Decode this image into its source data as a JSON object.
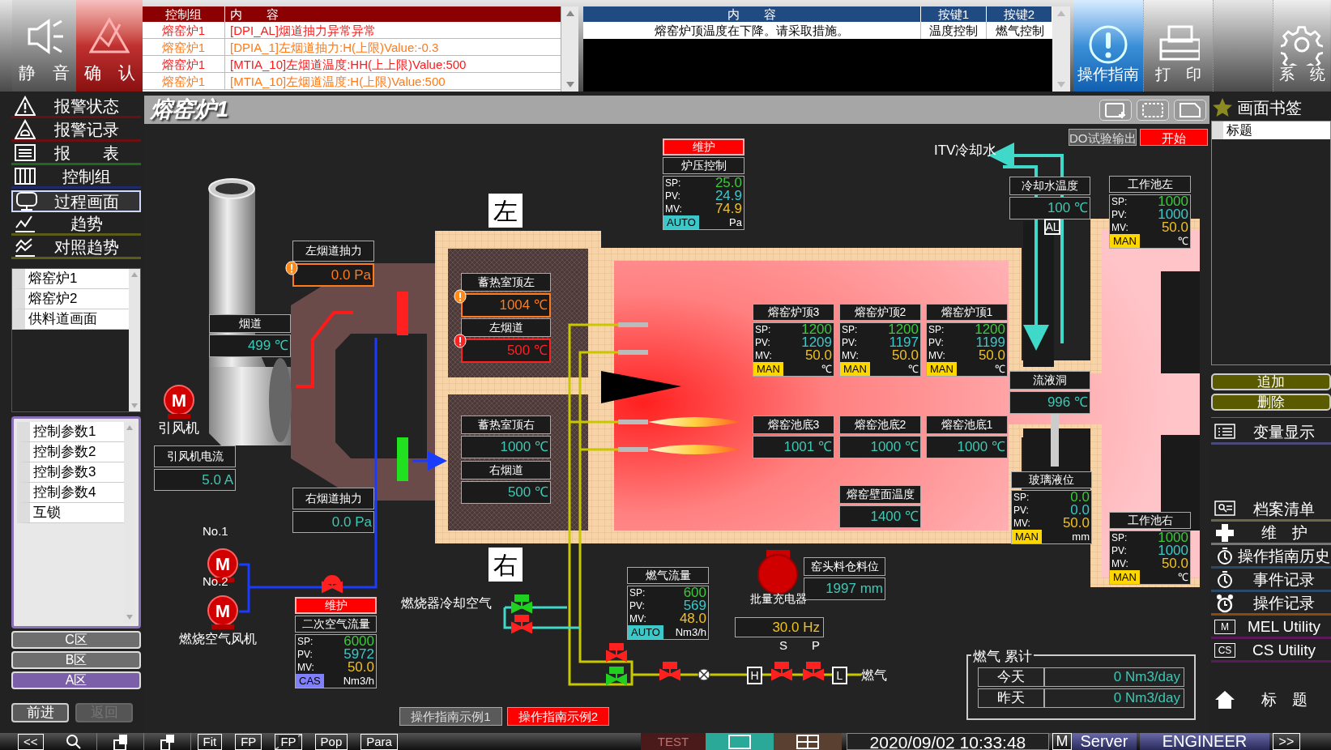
{
  "top_buttons": [
    {
      "label": "静　音",
      "kind": "mute"
    },
    {
      "label": "确　认",
      "kind": "ack"
    }
  ],
  "alarm_table": {
    "columns": [
      "控制组",
      "内　　容"
    ],
    "rows": [
      {
        "group": "熔窑炉1",
        "content": "[DPI_AL]烟道抽力异常异常",
        "kind": "hh"
      },
      {
        "group": "熔窑炉1",
        "content": "[DPIA_1]左烟道抽力:H(上限)Value:-0.3",
        "kind": "h"
      },
      {
        "group": "熔窑炉1",
        "content": "[MTIA_10]左烟道温度:HH(上上限)Value:500",
        "kind": "hh"
      },
      {
        "group": "熔窑炉1",
        "content": "[MTIA_10]左烟道温度:H(上限)Value:500",
        "kind": "h"
      }
    ]
  },
  "guidance_table": {
    "columns": [
      "内　　容",
      "按键1",
      "按键2"
    ],
    "rows": [
      {
        "content": "熔窑炉顶温度在下降。请采取措施。",
        "key1": "温度控制",
        "key2": "燃气控制"
      }
    ]
  },
  "right_buttons": [
    {
      "label": "操作指南",
      "kind": "guide",
      "selected": true
    },
    {
      "label": "打　印",
      "kind": "print",
      "selected": false
    },
    {
      "label": "系　统",
      "kind": "system",
      "selected": false
    }
  ],
  "nav": [
    {
      "label": "报警状态",
      "kind": "warn",
      "selected": false
    },
    {
      "label": "报警记录",
      "kind": "bell",
      "selected": false
    },
    {
      "label": "报　　表",
      "kind": "report",
      "selected": false
    },
    {
      "label": "控制组",
      "kind": "bars",
      "selected": false
    },
    {
      "label": "过程画面",
      "kind": "monitor",
      "selected": true
    },
    {
      "label": "趋势",
      "kind": "trend",
      "selected": false
    },
    {
      "label": "对照趋势",
      "kind": "compare",
      "selected": false
    }
  ],
  "screen_list": [
    "熔窑炉1",
    "熔窑炉2",
    "供料道画面"
  ],
  "param_list": [
    "控制参数1",
    "控制参数2",
    "控制参数3",
    "控制参数4",
    "互锁"
  ],
  "zones": [
    {
      "label": "C区",
      "selected": false
    },
    {
      "label": "B区",
      "selected": false
    },
    {
      "label": "A区",
      "selected": true
    }
  ],
  "history_buttons": [
    {
      "label": "前进",
      "disabled": false
    },
    {
      "label": "返回",
      "disabled": true
    }
  ],
  "title": "熔窑炉1",
  "canvas": {
    "values": [
      {
        "label": "左烟道抽力",
        "value": "0.0 Pa",
        "kind": "high"
      },
      {
        "label": "烟道",
        "value": "499 ℃",
        "kind": "normal"
      },
      {
        "label": "蓄热室顶左",
        "value": "1004 ℃",
        "kind": "high"
      },
      {
        "label": "左烟道",
        "value": "500 ℃",
        "kind": "highhigh"
      },
      {
        "label": "蓄热室顶右",
        "value": "1000 ℃",
        "kind": "normal"
      },
      {
        "label": "右烟道",
        "value": "500 ℃",
        "kind": "normal"
      },
      {
        "label": "引风机电流",
        "value": "5.0 A",
        "kind": "normal"
      },
      {
        "label": "右烟道抽力",
        "value": "0.0 Pa",
        "kind": "normal"
      },
      {
        "label": "冷却水温度",
        "value": "100 ℃",
        "kind": "normal"
      },
      {
        "label": "流液洞",
        "value": "996 ℃",
        "kind": "normal"
      },
      {
        "label": "熔窑池底3",
        "value": "1001 ℃",
        "kind": "normal"
      },
      {
        "label": "熔窑池底2",
        "value": "1000 ℃",
        "kind": "normal"
      },
      {
        "label": "熔窑池底1",
        "value": "1000 ℃",
        "kind": "normal"
      },
      {
        "label": "熔窑壁面温度",
        "value": "1400 ℃",
        "kind": "normal"
      },
      {
        "label": "窑头料仓料位",
        "value": "1997 mm",
        "kind": "normal"
      }
    ],
    "controllers": [
      {
        "badge": "维护",
        "label": "炉压控制",
        "rows": [
          {
            "key": "SP:",
            "value": "25.0"
          },
          {
            "key": "PV:",
            "value": "24.9"
          },
          {
            "key": "MV:",
            "value": "74.9"
          }
        ],
        "mode": {
          "label": "AUTO",
          "kind": "auto"
        },
        "unit": "Pa"
      },
      {
        "label": "熔窑炉顶3",
        "rows": [
          {
            "key": "SP:",
            "value": "1200"
          },
          {
            "key": "PV:",
            "value": "1209"
          },
          {
            "key": "MV:",
            "value": "50.0"
          }
        ],
        "mode": {
          "label": "MAN",
          "kind": "man"
        },
        "unit": "℃"
      },
      {
        "label": "熔窑炉顶2",
        "rows": [
          {
            "key": "SP:",
            "value": "1200"
          },
          {
            "key": "PV:",
            "value": "1197"
          },
          {
            "key": "MV:",
            "value": "50.0"
          }
        ],
        "mode": {
          "label": "MAN",
          "kind": "man"
        },
        "unit": "℃"
      },
      {
        "label": "熔窑炉顶1",
        "rows": [
          {
            "key": "SP:",
            "value": "1200"
          },
          {
            "key": "PV:",
            "value": "1199"
          },
          {
            "key": "MV:",
            "value": "50.0"
          }
        ],
        "mode": {
          "label": "MAN",
          "kind": "man"
        },
        "unit": "℃"
      },
      {
        "label": "工作池左",
        "rows": [
          {
            "key": "SP:",
            "value": "1000"
          },
          {
            "key": "PV:",
            "value": "1000"
          },
          {
            "key": "MV:",
            "value": "50.0"
          }
        ],
        "mode": {
          "label": "MAN",
          "kind": "man"
        },
        "unit": "℃"
      },
      {
        "label": "玻璃液位",
        "rows": [
          {
            "key": "SP:",
            "value": "0.0"
          },
          {
            "key": "PV:",
            "value": "0.0"
          },
          {
            "key": "MV:",
            "value": "50.0"
          }
        ],
        "mode": {
          "label": "MAN",
          "kind": "man"
        },
        "unit": "mm"
      },
      {
        "label": "工作池右",
        "rows": [
          {
            "key": "SP:",
            "value": "1000"
          },
          {
            "key": "PV:",
            "value": "1000"
          },
          {
            "key": "MV:",
            "value": "50.0"
          }
        ],
        "mode": {
          "label": "MAN",
          "kind": "man"
        },
        "unit": "℃"
      },
      {
        "label": "燃气流量",
        "rows": [
          {
            "key": "SP:",
            "value": "600"
          },
          {
            "key": "PV:",
            "value": "569"
          },
          {
            "key": "MV:",
            "value": "48.0"
          }
        ],
        "mode": {
          "label": "AUTO",
          "kind": "auto"
        },
        "unit": "Nm3/h"
      },
      {
        "badge": "维护",
        "label": "二次空气流量",
        "rows": [
          {
            "key": "SP:",
            "value": "6000"
          },
          {
            "key": "PV:",
            "value": "5972"
          },
          {
            "key": "MV:",
            "value": "50.0"
          }
        ],
        "mode": {
          "label": "CAS",
          "kind": "cas"
        },
        "unit": "Nm3/h"
      }
    ],
    "big_marks": [
      "左",
      "右"
    ],
    "labels": [
      "引风机",
      "No.1",
      "No.2",
      "燃烧空气风机",
      "燃烧器冷却空气",
      "批量充电器",
      "ITV冷却水",
      "燃气",
      "S",
      "P"
    ],
    "boxed_letters": [
      "H",
      "L",
      "AL"
    ],
    "motors": [
      {
        "symbol": "M"
      },
      {
        "symbol": "M"
      },
      {
        "symbol": "M"
      }
    ],
    "frequency": "30.0 Hz",
    "buttons": [
      {
        "label": "DO试验输出",
        "kind": "gray"
      },
      {
        "label": "开始",
        "kind": "red"
      },
      {
        "label": "操作指南示例1",
        "kind": "gray"
      },
      {
        "label": "操作指南示例2",
        "kind": "red"
      }
    ],
    "gas_total": {
      "title": "燃气 累计",
      "rows": [
        {
          "label": "今天",
          "value": "0 Nm3/day"
        },
        {
          "label": "昨天",
          "value": "0 Nm3/day"
        }
      ]
    }
  },
  "bookmarks": {
    "title": "画面书签",
    "column": "标题",
    "buttons": [
      "追加",
      "删除"
    ]
  },
  "right_menu": [
    {
      "label": "变量显示",
      "kind": "list"
    },
    {
      "label": "档案清单",
      "kind": "card"
    },
    {
      "label": "维　护",
      "kind": "cross"
    },
    {
      "label": "操作指南历史",
      "kind": "watch"
    },
    {
      "label": "事件记录",
      "kind": "watch"
    },
    {
      "label": "操作记录",
      "kind": "clock"
    },
    {
      "label": "MEL Utility",
      "kind": "boxtext",
      "badge": "M"
    },
    {
      "label": "CS Utility",
      "kind": "boxtext",
      "badge": "CS"
    },
    {
      "label": "标　题",
      "kind": "home"
    }
  ],
  "status_bar": {
    "tools": [
      {
        "label": "<<",
        "kind": "text"
      },
      {
        "kind": "search"
      },
      {
        "kind": "window"
      },
      {
        "kind": "windows"
      },
      {
        "label": "Fit",
        "kind": "text"
      },
      {
        "label": "FP",
        "kind": "text"
      },
      {
        "label": "FP",
        "kind": "crossed"
      },
      {
        "label": "Pop",
        "kind": "text"
      },
      {
        "label": "Para",
        "kind": "text"
      }
    ],
    "test": "TEST",
    "views": [
      {
        "kind": "single",
        "selected": true
      },
      {
        "kind": "quad",
        "selected": false
      }
    ],
    "datetime": "2020/09/02 10:33:48",
    "mode_icon": "M",
    "server": "Server",
    "user": "ENGINEER",
    "next": ">>"
  }
}
